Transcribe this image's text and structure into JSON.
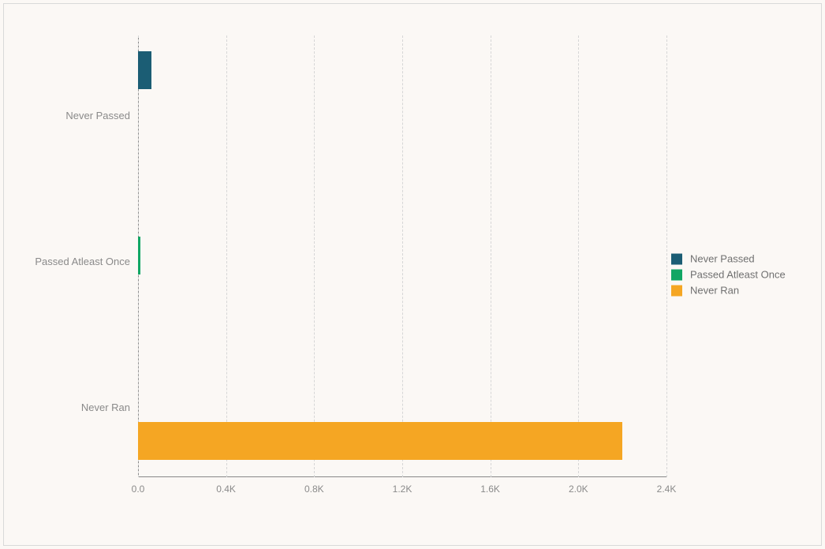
{
  "chart_data": {
    "type": "bar",
    "orientation": "horizontal",
    "categories": [
      "Never Passed",
      "Passed Atleast Once",
      "Never Ran"
    ],
    "series": [
      {
        "name": "Never Passed",
        "color": "#1b5d74",
        "values": [
          60,
          0,
          0
        ]
      },
      {
        "name": "Passed Atleast Once",
        "color": "#11a664",
        "values": [
          0,
          10,
          0
        ]
      },
      {
        "name": "Never Ran",
        "color": "#f5a623",
        "values": [
          0,
          0,
          2200
        ]
      }
    ],
    "xlim": [
      0,
      2400
    ],
    "x_ticks": [
      0,
      400,
      800,
      1200,
      1600,
      2000,
      2400
    ],
    "x_tick_labels": [
      "0.0",
      "0.4K",
      "0.8K",
      "1.2K",
      "1.6K",
      "2.0K",
      "2.4K"
    ],
    "title": "",
    "xlabel": "",
    "ylabel": ""
  },
  "legend": {
    "items": [
      {
        "label": "Never Passed",
        "color": "#1b5d74"
      },
      {
        "label": "Passed Atleast Once",
        "color": "#11a664"
      },
      {
        "label": "Never Ran",
        "color": "#f5a623"
      }
    ]
  }
}
